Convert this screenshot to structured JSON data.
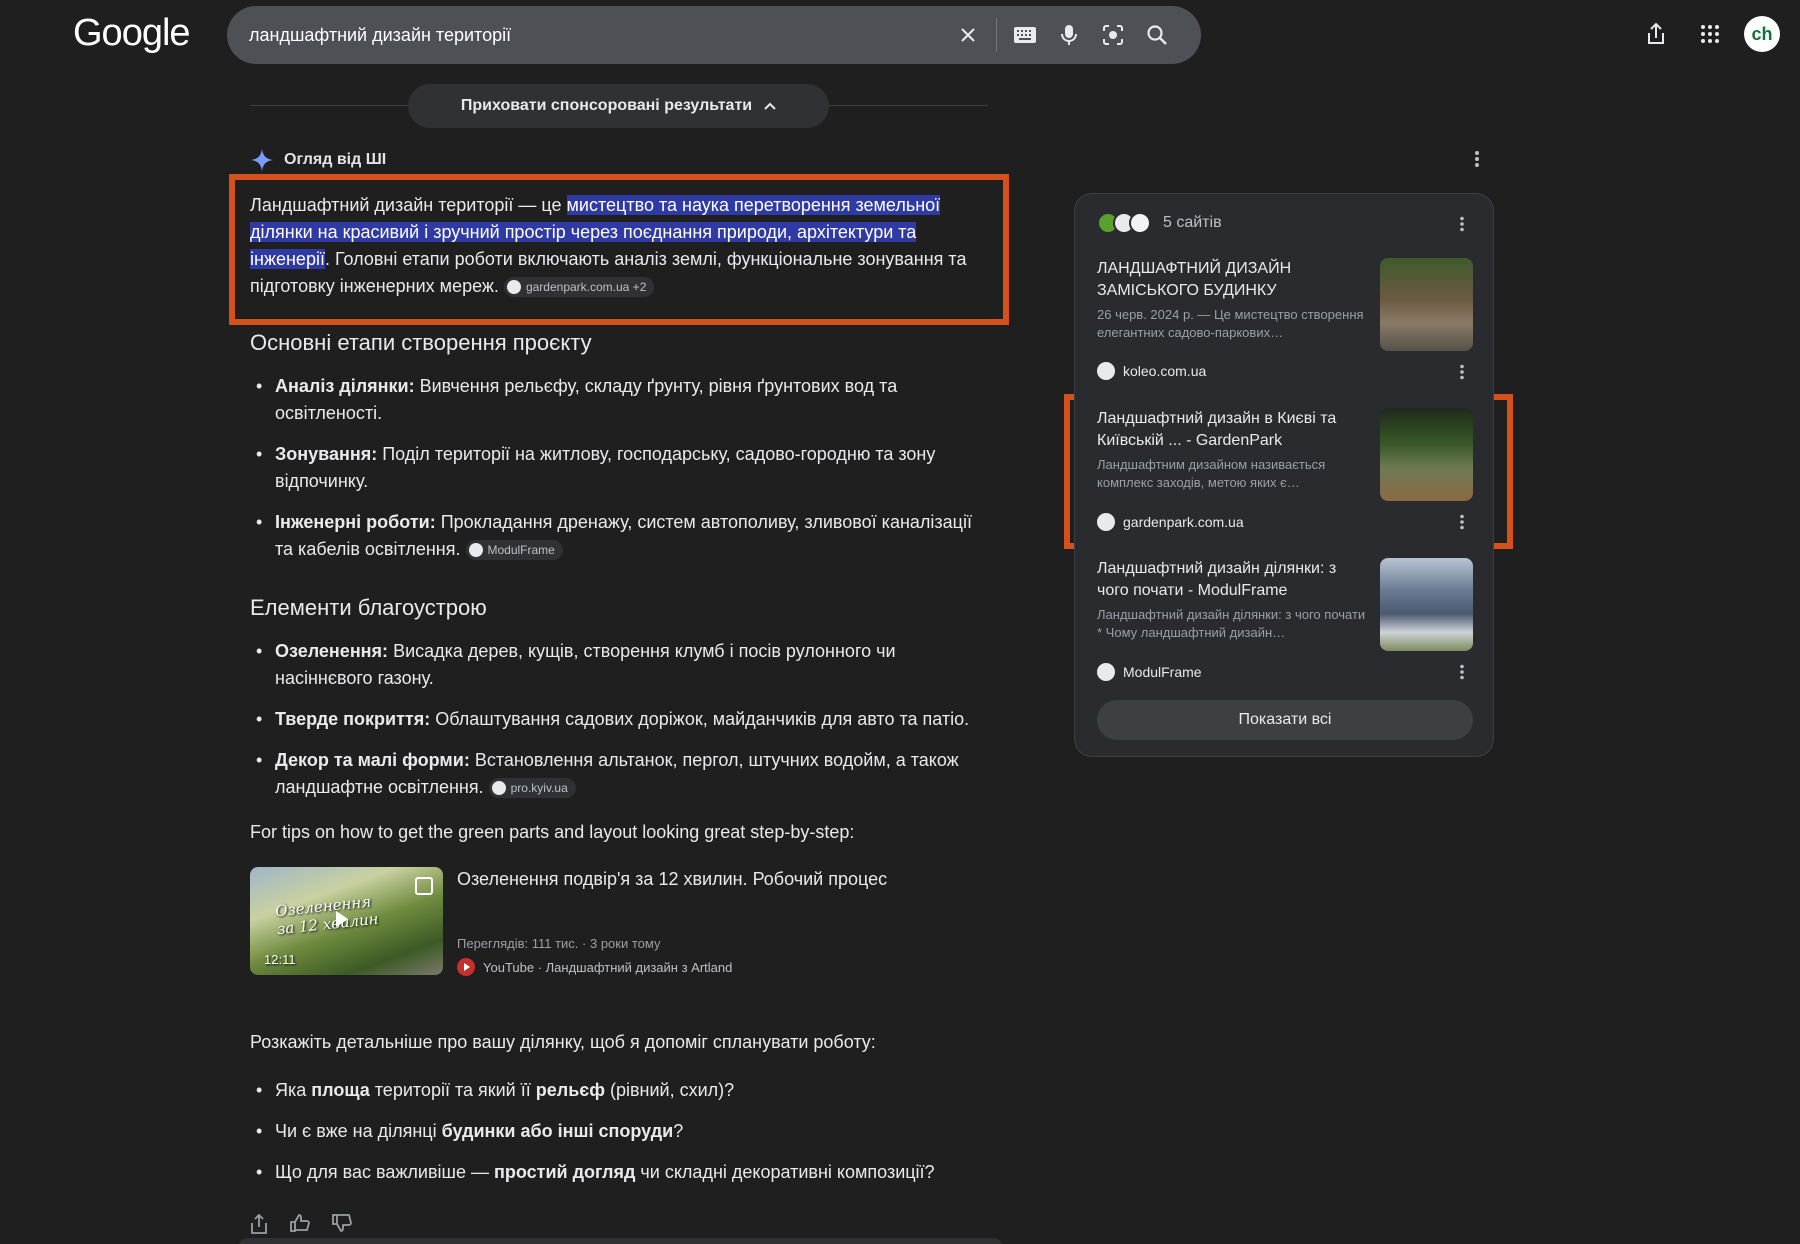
{
  "header": {
    "logo": "Google",
    "search_query": "ландшафтний дизайн території",
    "avatar_text": "ch"
  },
  "sponsored": {
    "toggle_label": "Приховати спонсоровані результати"
  },
  "ai_overview": {
    "title": "Огляд від ШІ",
    "intro_prefix": "Ландшафтний дизайн території — це ",
    "intro_highlight": "мистецтво та наука перетворення земельної ділянки на красивий і зручний простір через поєднання природи, архітектури та інженерії",
    "intro_suffix": ". Головні етапи роботи включають аналіз землі, функціональне зонування та підготовку інженерних мереж.",
    "intro_chip": "gardenpark.com.ua +2",
    "section1_title": "Основні етапи створення проєкту",
    "section1_items": [
      {
        "bold": "Аналіз ділянки:",
        "text": " Вивчення рельєфу, складу ґрунту, рівня ґрунтових вод та освітленості."
      },
      {
        "bold": "Зонування:",
        "text": " Поділ території на житлову, господарську, садово-городню та зону відпочинку."
      },
      {
        "bold": "Інженерні роботи:",
        "text": " Прокладання дренажу, систем автополиву, зливової каналізації та кабелів освітлення."
      }
    ],
    "section1_chip": "ModulFrame",
    "section2_title": "Елементи благоустрою",
    "section2_items": [
      {
        "bold": "Озеленення:",
        "text": " Висадка дерев, кущів, створення клумб і посів рулонного чи насіннєвого газону."
      },
      {
        "bold": "Тверде покриття:",
        "text": " Облаштування садових доріжок, майданчиків для авто та патіо."
      },
      {
        "bold": "Декор та малі форми:",
        "text": " Встановлення альтанок, пергол, штучних водойм, а також ландшафтне освітлення."
      }
    ],
    "section2_chip": "pro.kyiv.ua",
    "tips_text": "For tips on how to get the green parts and layout looking great step-by-step:",
    "video": {
      "thumb_text_1": "Озеленення",
      "thumb_text_2": "за 12 хвилин",
      "duration": "12:11",
      "title": "Озеленення подвір'я за 12 хвилин. Робочий процес",
      "meta": "Переглядів: 111 тис. · 3 роки тому",
      "source": "YouTube · Ландшафтний дизайн з Artland"
    },
    "ask_text": "Розкажіть детальніше про вашу ділянку, щоб я допоміг спланувати роботу:",
    "questions": [
      {
        "a": "Яка ",
        "b": "площа",
        "c": " території та який її ",
        "d": "рельєф",
        "e": " (рівний, схил)?"
      },
      {
        "a": "Чи є вже на ділянці ",
        "b": "будинки або інші споруди",
        "c": "?",
        "d": "",
        "e": ""
      },
      {
        "a": "Що для вас важливіше — ",
        "b": "простий догляд",
        "c": " чи складні декоративні композиції?",
        "d": "",
        "e": ""
      }
    ]
  },
  "sources_card": {
    "count_label": "5 сайтів",
    "sources": [
      {
        "title": "ЛАНДШАФТНИЙ ДИЗАЙН ЗАМІСЬКОГО БУДИНКУ",
        "snippet": "26 черв. 2024 р. — Це мистецтво створення елегантних садово-паркових…",
        "site": "koleo.com.ua"
      },
      {
        "title": "Ландшафтний дизайн в Києві та Київській ... - GardenPark",
        "snippet": "Ландшафтним дизайном називається комплекс заходів, метою яких є…",
        "site": "gardenpark.com.ua"
      },
      {
        "title": "Ландшафтний дизайн ділянки: з чого почати - ModulFrame",
        "snippet": "Ландшафтний дизайн ділянки: з чого почати * Чому ландшафтний дизайн…",
        "site": "ModulFrame"
      }
    ],
    "show_all": "Показати всі"
  },
  "colors": {
    "background": "#1f1f1f",
    "highlight": "#2f3aa5",
    "annotation_box": "#d4511c"
  }
}
